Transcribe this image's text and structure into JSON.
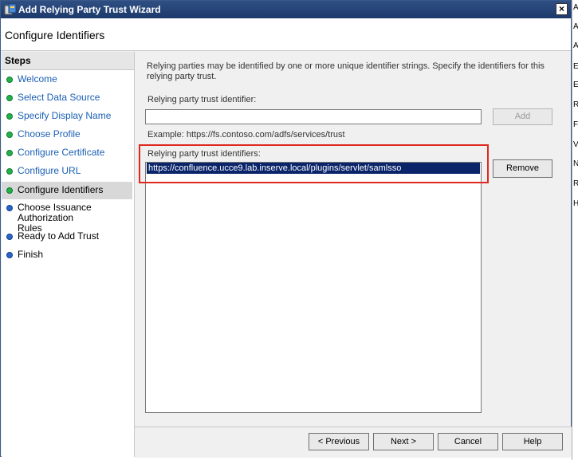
{
  "window": {
    "title": "Add Relying Party Trust Wizard",
    "close_glyph": "×"
  },
  "header": {
    "title": "Configure Identifiers"
  },
  "steps": {
    "heading": "Steps",
    "items": [
      {
        "label": "Welcome",
        "state": "done"
      },
      {
        "label": "Select Data Source",
        "state": "done"
      },
      {
        "label": "Specify Display Name",
        "state": "done"
      },
      {
        "label": "Choose Profile",
        "state": "done"
      },
      {
        "label": "Configure Certificate",
        "state": "done"
      },
      {
        "label": "Configure URL",
        "state": "done"
      },
      {
        "label": "Configure Identifiers",
        "state": "current"
      },
      {
        "label": "Choose Issuance Authorization Rules",
        "state": "todo"
      },
      {
        "label": "Ready to Add Trust",
        "state": "todo"
      },
      {
        "label": "Finish",
        "state": "todo"
      }
    ]
  },
  "content": {
    "description": "Relying parties may be identified by one or more unique identifier strings. Specify the identifiers for this relying party trust.",
    "identifier_label": "Relying party trust identifier:",
    "identifier_value": "",
    "add_button": "Add",
    "example": "Example: https://fs.contoso.com/adfs/services/trust",
    "identifiers_label": "Relying party trust identifiers:",
    "identifiers": [
      "https://confluence.ucce9.lab.inserve.local/plugins/servlet/samlsso"
    ],
    "remove_button": "Remove"
  },
  "footer": {
    "previous": "< Previous",
    "next": "Next >",
    "cancel": "Cancel",
    "help": "Help"
  },
  "background_strip": [
    "A",
    "A",
    "A",
    "E",
    "E",
    "R",
    "F",
    "V",
    "N",
    "R",
    "H"
  ],
  "colors": {
    "titlebar": "#1c3a6b",
    "selection": "#0a246a",
    "highlight_box": "#e0281e",
    "step_done_dot": "#22b24c",
    "step_todo_dot": "#2a66c9",
    "step_link": "#1a5fb4"
  }
}
